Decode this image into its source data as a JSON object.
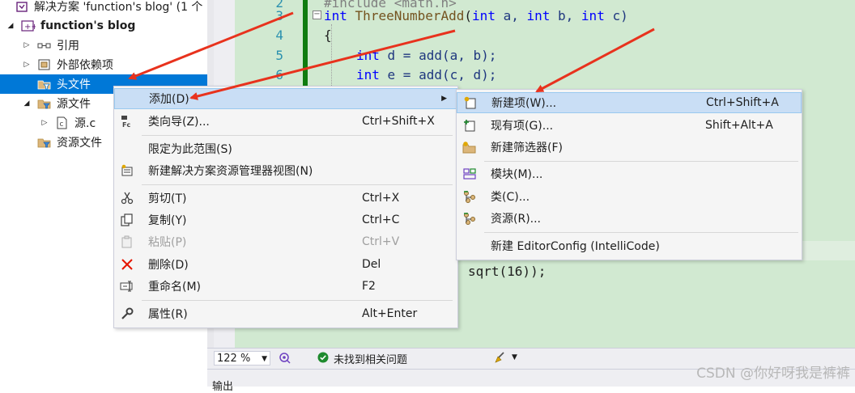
{
  "solution_explorer": {
    "rows": [
      {
        "label": "解决方案 'function's blog' (1 个",
        "icon": "solution-icon"
      },
      {
        "label": "function's blog",
        "icon": "project-icon",
        "toggle": "◢"
      },
      {
        "label": "引用",
        "icon": "references-icon",
        "toggle": "▷"
      },
      {
        "label": "外部依赖项",
        "icon": "external-deps-icon",
        "toggle": "▷"
      },
      {
        "label": "头文件",
        "icon": "filter-folder-icon"
      },
      {
        "label": "源文件",
        "icon": "filter-folder-icon",
        "toggle": "◢"
      },
      {
        "label": "源.c",
        "icon": "c-file-icon",
        "toggle": "▷"
      },
      {
        "label": "资源文件",
        "icon": "filter-folder-icon"
      }
    ]
  },
  "editor": {
    "line_numbers": [
      "3",
      "4",
      "5",
      "6"
    ],
    "include_fragment": "#include <math.h>",
    "line3": {
      "kw1": "int",
      "fn": "ThreeNumberAdd",
      "p1": "(",
      "kw2": "int",
      "a": " a, ",
      "kw3": "int",
      "b": " b, ",
      "kw4": "int",
      "c": " c)"
    },
    "line4": "{",
    "line5": {
      "kw": "int",
      "rest": " d = add(a, b);"
    },
    "line6": {
      "kw": "int",
      "rest": " e = add(c, d);"
    },
    "fragment": "sqrt(16));"
  },
  "status_bar": {
    "zoom": "122 %",
    "issues": "未找到相关问题",
    "output_tab": "输出"
  },
  "watermark": "CSDN @你好呀我是裤裤",
  "context_menu": [
    {
      "label": "添加(D)",
      "shortcut": "",
      "icon": "",
      "submenu": true,
      "highlighted": true
    },
    {
      "label": "类向导(Z)...",
      "shortcut": "Ctrl+Shift+X",
      "icon": "class-wizard-icon"
    },
    {
      "label": "限定为此范围(S)",
      "shortcut": "",
      "icon": ""
    },
    {
      "label": "新建解决方案资源管理器视图(N)",
      "shortcut": "",
      "icon": "new-view-icon"
    },
    {
      "label": "剪切(T)",
      "shortcut": "Ctrl+X",
      "icon": "cut-icon"
    },
    {
      "label": "复制(Y)",
      "shortcut": "Ctrl+C",
      "icon": "copy-icon"
    },
    {
      "label": "粘贴(P)",
      "shortcut": "Ctrl+V",
      "icon": "paste-icon",
      "disabled": true
    },
    {
      "label": "删除(D)",
      "shortcut": "Del",
      "icon": "delete-icon"
    },
    {
      "label": "重命名(M)",
      "shortcut": "F2",
      "icon": "rename-icon"
    },
    {
      "label": "属性(R)",
      "shortcut": "Alt+Enter",
      "icon": "wrench-icon"
    }
  ],
  "submenu": [
    {
      "label": "新建项(W)...",
      "shortcut": "Ctrl+Shift+A",
      "icon": "new-item-icon",
      "highlighted": true
    },
    {
      "label": "现有项(G)...",
      "shortcut": "Shift+Alt+A",
      "icon": "existing-item-icon"
    },
    {
      "label": "新建筛选器(F)",
      "shortcut": "",
      "icon": "new-filter-icon"
    },
    {
      "label": "模块(M)...",
      "shortcut": "",
      "icon": "module-icon"
    },
    {
      "label": "类(C)...",
      "shortcut": "",
      "icon": "class-icon"
    },
    {
      "label": "资源(R)...",
      "shortcut": "",
      "icon": "resource-icon"
    },
    {
      "label": "新建 EditorConfig (IntelliCode)",
      "shortcut": "",
      "icon": ""
    }
  ],
  "colors": {
    "selection": "#0078d7",
    "editor_bg": "#d1e9d1",
    "menu_highlight": "#c9def5",
    "annotation_arrow": "#e8321d"
  }
}
